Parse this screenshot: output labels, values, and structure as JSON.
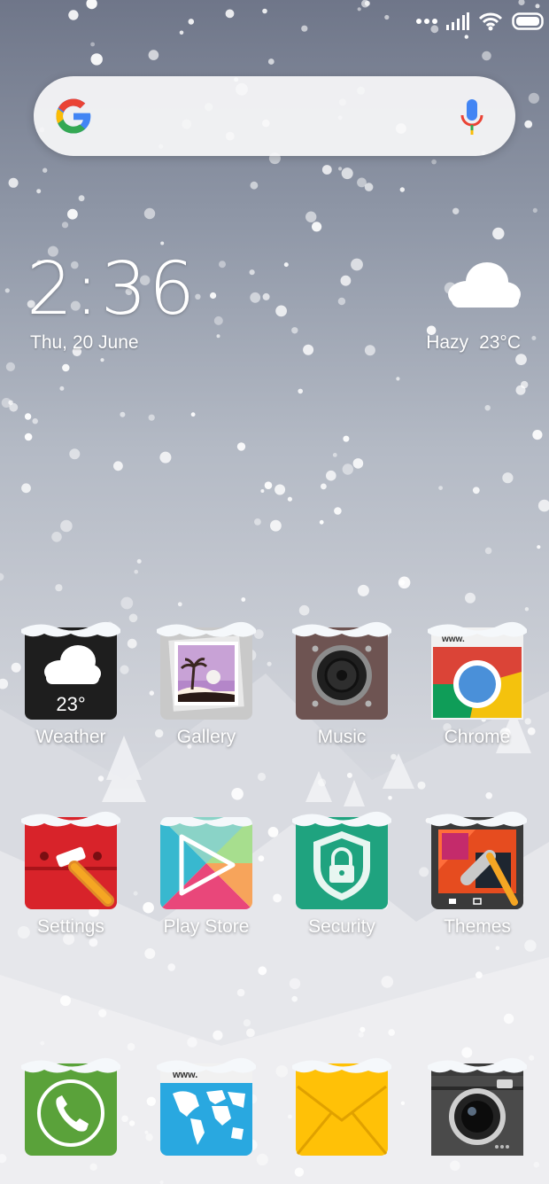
{
  "status_bar": {
    "icons": [
      "more-dots-icon",
      "signal-icon",
      "wifi-icon",
      "battery-icon"
    ]
  },
  "search": {
    "logo_icon": "google-g-icon",
    "mic_icon": "mic-icon"
  },
  "clock": {
    "time": "2:36",
    "date": "Thu, 20 June"
  },
  "weather_widget": {
    "icon": "cloud-icon",
    "condition": "Hazy",
    "temperature": "23°C"
  },
  "apps_row1": [
    {
      "label": "Weather",
      "icon": "weather-icon",
      "badge": "23°"
    },
    {
      "label": "Gallery",
      "icon": "gallery-icon"
    },
    {
      "label": "Music",
      "icon": "speaker-icon"
    },
    {
      "label": "Chrome",
      "icon": "chrome-icon",
      "tab_text": "www."
    }
  ],
  "apps_row2": [
    {
      "label": "Settings",
      "icon": "settings-wrench-icon"
    },
    {
      "label": "Play Store",
      "icon": "play-store-icon"
    },
    {
      "label": "Security",
      "icon": "security-lock-icon"
    },
    {
      "label": "Themes",
      "icon": "themes-brush-icon"
    }
  ],
  "dock": [
    {
      "name": "Phone",
      "icon": "phone-icon"
    },
    {
      "name": "Browser",
      "icon": "browser-globe-icon",
      "tab_text": "www."
    },
    {
      "name": "Messaging",
      "icon": "envelope-icon"
    },
    {
      "name": "Camera",
      "icon": "camera-icon"
    }
  ],
  "colors": {
    "weather_bg": "#1e1e1e",
    "settings_red": "#d8232a",
    "security_green": "#1fa37f",
    "phone_green": "#5aa23a",
    "browser_blue": "#29a8e0",
    "mail_yellow": "#ffc107",
    "camera_dark": "#3b3b3b",
    "music_brown": "#6e5452",
    "chrome_red": "#db4437",
    "chrome_yellow": "#f4c20d",
    "chrome_green": "#0f9d58",
    "chrome_blue": "#4285f4"
  }
}
